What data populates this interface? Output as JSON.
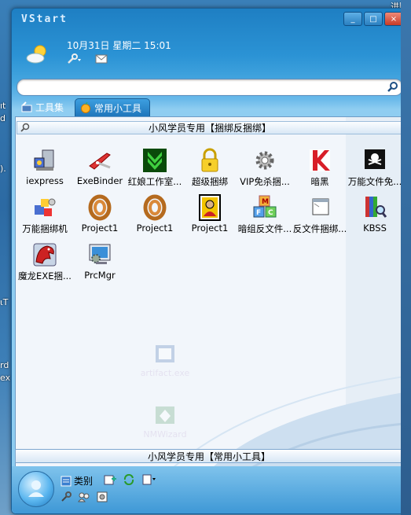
{
  "desktop": {
    "right_text": "进阶",
    "left_fragments": [
      "ıt",
      "d",
      ").",
      "ιT",
      "rd",
      "ex"
    ]
  },
  "window": {
    "title": "VStart",
    "buttons": [
      "_",
      "□",
      "×"
    ]
  },
  "header": {
    "datetime": "10月31日 星期二 15:01"
  },
  "search": {
    "placeholder": "",
    "value": ""
  },
  "tabs": [
    {
      "label": "工具集",
      "active": false
    },
    {
      "label": "常用小工具",
      "active": true
    }
  ],
  "group": {
    "header": "小风学员专用【捆绑反捆绑】",
    "footer": "小风学员专用【常用小工具】"
  },
  "icons": [
    {
      "label": "iexpress",
      "icon": "installer-icon"
    },
    {
      "label": "ExeBinder",
      "icon": "knife-icon"
    },
    {
      "label": "红娘工作室...",
      "icon": "download-arrow-icon"
    },
    {
      "label": "超级捆绑",
      "icon": "padlock-icon"
    },
    {
      "label": "VIP免杀捆...",
      "icon": "gear-icon"
    },
    {
      "label": "暗黑",
      "icon": "kaspersky-icon"
    },
    {
      "label": "万能文件免...",
      "icon": "pirate-flag-icon"
    },
    {
      "label": "万能捆绑机",
      "icon": "blocks-icon"
    },
    {
      "label": "Project1",
      "icon": "rope-icon"
    },
    {
      "label": "Project1",
      "icon": "rope-icon"
    },
    {
      "label": "Project1",
      "icon": "card-icon"
    },
    {
      "label": "暗组反文件...",
      "icon": "mfc-blocks-icon"
    },
    {
      "label": "反文件捆绑...",
      "icon": "window-icon"
    },
    {
      "label": "KBSS",
      "icon": "books-search-icon"
    },
    {
      "label": "魔龙EXE捆...",
      "icon": "dragon-icon"
    },
    {
      "label": "PrcMgr",
      "icon": "monitor-gear-icon"
    }
  ],
  "ghosts": [
    {
      "label": "artifact.exe"
    },
    {
      "label": "NMWizard"
    }
  ],
  "bottom": {
    "category_label": "类别"
  },
  "colors": {
    "accent": "#2b93d5",
    "panel": "#f2f6fb"
  }
}
